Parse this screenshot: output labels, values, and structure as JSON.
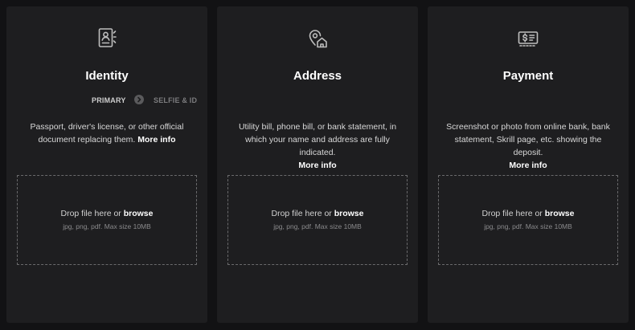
{
  "colors": {
    "page_bg": "#121214",
    "card_bg": "#1e1e20",
    "text_primary": "#ffffff",
    "text_secondary": "#d8d8d8",
    "text_muted": "#8a8a8c",
    "dashed_border": "#6a6a6c"
  },
  "cards": [
    {
      "icon": "id-document-icon",
      "title": "Identity",
      "steps": {
        "primary": "PRIMARY",
        "arrow_icon": "chevron-right-circle-icon",
        "secondary": "SELFIE & ID"
      },
      "description": "Passport, driver's license, or other official document replacing them.",
      "more_info": "More info",
      "dropzone": {
        "text": "Drop file here or",
        "browse": "browse",
        "hint": "jpg, png, pdf. Max size 10MB"
      }
    },
    {
      "icon": "location-home-icon",
      "title": "Address",
      "description": "Utility bill, phone bill, or bank statement, in which your name and address are fully indicated.",
      "more_info": "More info",
      "dropzone": {
        "text": "Drop file here or",
        "browse": "browse",
        "hint": "jpg, png, pdf. Max size 10MB"
      }
    },
    {
      "icon": "payment-card-icon",
      "title": "Payment",
      "description": "Screenshot or photo from online bank, bank statement, Skrill page, etc. showing the deposit.",
      "more_info": "More info",
      "dropzone": {
        "text": "Drop file here or",
        "browse": "browse",
        "hint": "jpg, png, pdf. Max size 10MB"
      }
    }
  ]
}
